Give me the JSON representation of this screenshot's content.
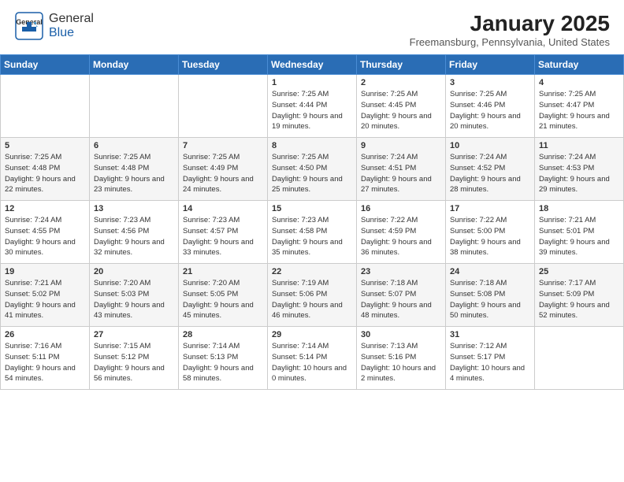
{
  "header": {
    "logo_general": "General",
    "logo_blue": "Blue",
    "month": "January 2025",
    "location": "Freemansburg, Pennsylvania, United States"
  },
  "weekdays": [
    "Sunday",
    "Monday",
    "Tuesday",
    "Wednesday",
    "Thursday",
    "Friday",
    "Saturday"
  ],
  "weeks": [
    [
      {
        "day": "",
        "sunrise": "",
        "sunset": "",
        "daylight": ""
      },
      {
        "day": "",
        "sunrise": "",
        "sunset": "",
        "daylight": ""
      },
      {
        "day": "",
        "sunrise": "",
        "sunset": "",
        "daylight": ""
      },
      {
        "day": "1",
        "sunrise": "7:25 AM",
        "sunset": "4:44 PM",
        "daylight": "9 hours and 19 minutes."
      },
      {
        "day": "2",
        "sunrise": "7:25 AM",
        "sunset": "4:45 PM",
        "daylight": "9 hours and 20 minutes."
      },
      {
        "day": "3",
        "sunrise": "7:25 AM",
        "sunset": "4:46 PM",
        "daylight": "9 hours and 20 minutes."
      },
      {
        "day": "4",
        "sunrise": "7:25 AM",
        "sunset": "4:47 PM",
        "daylight": "9 hours and 21 minutes."
      }
    ],
    [
      {
        "day": "5",
        "sunrise": "7:25 AM",
        "sunset": "4:48 PM",
        "daylight": "9 hours and 22 minutes."
      },
      {
        "day": "6",
        "sunrise": "7:25 AM",
        "sunset": "4:48 PM",
        "daylight": "9 hours and 23 minutes."
      },
      {
        "day": "7",
        "sunrise": "7:25 AM",
        "sunset": "4:49 PM",
        "daylight": "9 hours and 24 minutes."
      },
      {
        "day": "8",
        "sunrise": "7:25 AM",
        "sunset": "4:50 PM",
        "daylight": "9 hours and 25 minutes."
      },
      {
        "day": "9",
        "sunrise": "7:24 AM",
        "sunset": "4:51 PM",
        "daylight": "9 hours and 27 minutes."
      },
      {
        "day": "10",
        "sunrise": "7:24 AM",
        "sunset": "4:52 PM",
        "daylight": "9 hours and 28 minutes."
      },
      {
        "day": "11",
        "sunrise": "7:24 AM",
        "sunset": "4:53 PM",
        "daylight": "9 hours and 29 minutes."
      }
    ],
    [
      {
        "day": "12",
        "sunrise": "7:24 AM",
        "sunset": "4:55 PM",
        "daylight": "9 hours and 30 minutes."
      },
      {
        "day": "13",
        "sunrise": "7:23 AM",
        "sunset": "4:56 PM",
        "daylight": "9 hours and 32 minutes."
      },
      {
        "day": "14",
        "sunrise": "7:23 AM",
        "sunset": "4:57 PM",
        "daylight": "9 hours and 33 minutes."
      },
      {
        "day": "15",
        "sunrise": "7:23 AM",
        "sunset": "4:58 PM",
        "daylight": "9 hours and 35 minutes."
      },
      {
        "day": "16",
        "sunrise": "7:22 AM",
        "sunset": "4:59 PM",
        "daylight": "9 hours and 36 minutes."
      },
      {
        "day": "17",
        "sunrise": "7:22 AM",
        "sunset": "5:00 PM",
        "daylight": "9 hours and 38 minutes."
      },
      {
        "day": "18",
        "sunrise": "7:21 AM",
        "sunset": "5:01 PM",
        "daylight": "9 hours and 39 minutes."
      }
    ],
    [
      {
        "day": "19",
        "sunrise": "7:21 AM",
        "sunset": "5:02 PM",
        "daylight": "9 hours and 41 minutes."
      },
      {
        "day": "20",
        "sunrise": "7:20 AM",
        "sunset": "5:03 PM",
        "daylight": "9 hours and 43 minutes."
      },
      {
        "day": "21",
        "sunrise": "7:20 AM",
        "sunset": "5:05 PM",
        "daylight": "9 hours and 45 minutes."
      },
      {
        "day": "22",
        "sunrise": "7:19 AM",
        "sunset": "5:06 PM",
        "daylight": "9 hours and 46 minutes."
      },
      {
        "day": "23",
        "sunrise": "7:18 AM",
        "sunset": "5:07 PM",
        "daylight": "9 hours and 48 minutes."
      },
      {
        "day": "24",
        "sunrise": "7:18 AM",
        "sunset": "5:08 PM",
        "daylight": "9 hours and 50 minutes."
      },
      {
        "day": "25",
        "sunrise": "7:17 AM",
        "sunset": "5:09 PM",
        "daylight": "9 hours and 52 minutes."
      }
    ],
    [
      {
        "day": "26",
        "sunrise": "7:16 AM",
        "sunset": "5:11 PM",
        "daylight": "9 hours and 54 minutes."
      },
      {
        "day": "27",
        "sunrise": "7:15 AM",
        "sunset": "5:12 PM",
        "daylight": "9 hours and 56 minutes."
      },
      {
        "day": "28",
        "sunrise": "7:14 AM",
        "sunset": "5:13 PM",
        "daylight": "9 hours and 58 minutes."
      },
      {
        "day": "29",
        "sunrise": "7:14 AM",
        "sunset": "5:14 PM",
        "daylight": "10 hours and 0 minutes."
      },
      {
        "day": "30",
        "sunrise": "7:13 AM",
        "sunset": "5:16 PM",
        "daylight": "10 hours and 2 minutes."
      },
      {
        "day": "31",
        "sunrise": "7:12 AM",
        "sunset": "5:17 PM",
        "daylight": "10 hours and 4 minutes."
      },
      {
        "day": "",
        "sunrise": "",
        "sunset": "",
        "daylight": ""
      }
    ]
  ],
  "labels": {
    "sunrise_prefix": "Sunrise: ",
    "sunset_prefix": "Sunset: ",
    "daylight_prefix": "Daylight: "
  }
}
